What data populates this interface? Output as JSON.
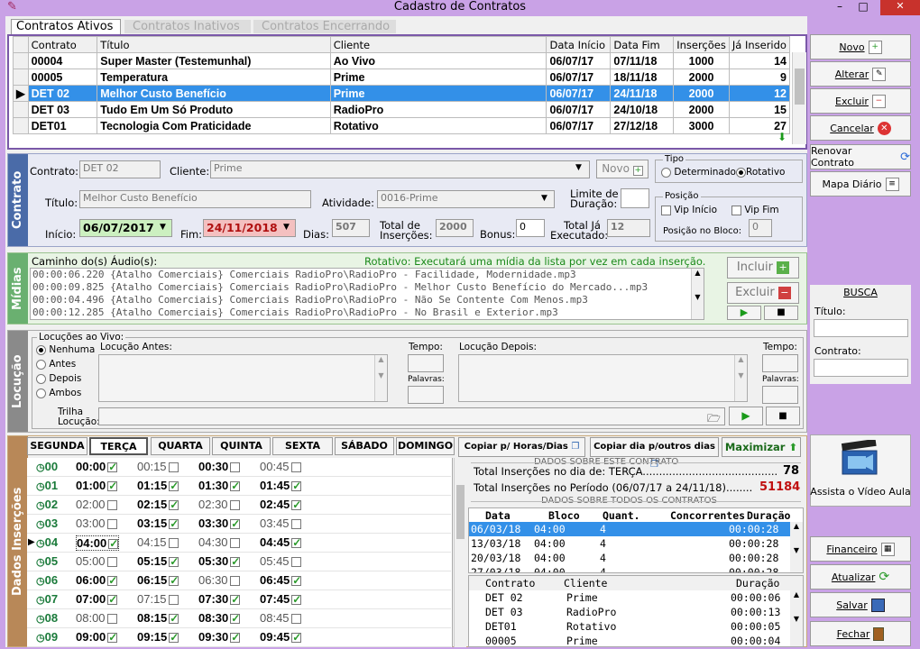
{
  "window": {
    "title": "Cadastro de Contratos",
    "min": "–",
    "max": "□",
    "close": "✕"
  },
  "tabs": [
    "Contratos Ativos",
    "Contratos Inativos",
    "Contratos Encerrando"
  ],
  "table": {
    "headers": [
      "Contrato",
      "Título",
      "Cliente",
      "Data Início",
      "Data Fim",
      "Inserções",
      "Já Inserido"
    ],
    "rows": [
      [
        "00004",
        "Super Master (Testemunhal)",
        "Ao Vivo",
        "06/07/17",
        "07/11/18",
        "1000",
        "14"
      ],
      [
        "00005",
        "Temperatura",
        "Prime",
        "06/07/17",
        "18/11/18",
        "2000",
        "9"
      ],
      [
        "DET 02",
        "Melhor Custo Benefício",
        "Prime",
        "06/07/17",
        "24/11/18",
        "2000",
        "12"
      ],
      [
        "DET 03",
        "Tudo Em Um Só Produto",
        "RadioPro",
        "06/07/17",
        "24/10/18",
        "2000",
        "15"
      ],
      [
        "DET01",
        "Tecnologia Com Praticidade",
        "Rotativo",
        "06/07/17",
        "27/12/18",
        "3000",
        "27"
      ]
    ],
    "selected_row": 2
  },
  "side": {
    "novo": "Novo",
    "alterar": "Alterar",
    "excluir": "Excluir",
    "cancelar": "Cancelar",
    "renovar": "Renovar Contrato",
    "mapa": "Mapa Diário",
    "busca": "BUSCA",
    "titulo_lbl": "Título:",
    "contrato_lbl": "Contrato:",
    "video": "Assista o Vídeo Aula",
    "financeiro": "Financeiro",
    "atualizar": "Atualizar",
    "salvar": "Salvar",
    "fechar": "Fechar"
  },
  "contrato": {
    "section": "Contrato",
    "contrato_lbl": "Contrato:",
    "contrato_val": "DET 02",
    "cliente_lbl": "Cliente:",
    "cliente_val": "Prime",
    "novo_btn": "Novo",
    "titulo_lbl": "Título:",
    "titulo_val": "Melhor Custo Benefício",
    "atividade_lbl": "Atividade:",
    "atividade_val": "0016-Prime",
    "limite_lbl1": "Limite de",
    "limite_lbl2": "Duração:",
    "inicio_lbl": "Início:",
    "inicio_val": "06/07/2017",
    "fim_lbl": "Fim:",
    "fim_val": "24/11/2018",
    "dias_lbl": "Dias:",
    "dias_val": "507",
    "total_ins_lbl1": "Total de",
    "total_ins_lbl2": "Inserções:",
    "total_ins_val": "2000",
    "bonus_lbl": "Bonus:",
    "bonus_val": "0",
    "total_exec_lbl1": "Total Já",
    "total_exec_lbl2": "Executado:",
    "total_exec_val": "12",
    "tipo_lbl": "Tipo",
    "determinado": "Determinado",
    "rotativo": "Rotativo",
    "posicao_lbl": "Posição",
    "vip_inicio": "Vip Início",
    "vip_fim": "Vip Fim",
    "posicao_bloco_lbl": "Posição no Bloco:",
    "posicao_bloco_val": "0"
  },
  "midias": {
    "section": "Mídias",
    "caminho_lbl": "Caminho  do(s)  Áudio(s):",
    "rotativo_info": "Rotativo: Executará uma mídia da lista por vez em cada inserção.",
    "files": [
      "00:00:06.220 {Atalho Comerciais} Comerciais RadioPro\\RadioPro - Facilidade, Modernidade.mp3",
      "00:00:09.825 {Atalho Comerciais} Comerciais RadioPro\\RadioPro - Melhor Custo Benefício do Mercado...mp3",
      "00:00:04.496 {Atalho Comerciais} Comerciais RadioPro\\RadioPro - Não Se Contente Com Menos.mp3",
      "00:00:12.285 {Atalho Comerciais} Comerciais RadioPro\\RadioPro - No Brasil e Exterior.mp3"
    ],
    "incluir": "Incluir",
    "excluir": "Excluir"
  },
  "locucao": {
    "section": "Locução",
    "group_lbl": "Locuções ao Vivo:",
    "options": [
      "Nenhuma",
      "Antes",
      "Depois",
      "Ambos"
    ],
    "antes_lbl": "Locução Antes:",
    "tempo_lbl": "Tempo:",
    "palavras_lbl": "Palavras:",
    "depois_lbl": "Locução Depois:",
    "trilha_lbl1": "Trilha",
    "trilha_lbl2": "Locução:"
  },
  "insercoes": {
    "section": "Dados Inserções",
    "days": [
      "SEGUNDA",
      "TERÇA",
      "QUARTA",
      "QUINTA",
      "SEXTA",
      "SÁBADO",
      "DOMINGO"
    ],
    "active_day": 1,
    "copiar_horas": "Copiar p/ Horas/Dias",
    "copiar_dia": "Copiar dia p/outros dias",
    "maximizar": "Maximizar",
    "hours": [
      {
        "h": "00",
        "slots": [
          [
            "00:00",
            true,
            true
          ],
          [
            "00:15",
            false,
            false
          ],
          [
            "00:30",
            true,
            false
          ],
          [
            "00:45",
            false,
            false
          ]
        ]
      },
      {
        "h": "01",
        "slots": [
          [
            "01:00",
            true,
            true
          ],
          [
            "01:15",
            true,
            true
          ],
          [
            "01:30",
            true,
            true
          ],
          [
            "01:45",
            true,
            true
          ]
        ]
      },
      {
        "h": "02",
        "slots": [
          [
            "02:00",
            false,
            false
          ],
          [
            "02:15",
            true,
            true
          ],
          [
            "02:30",
            false,
            false
          ],
          [
            "02:45",
            true,
            true
          ]
        ]
      },
      {
        "h": "03",
        "slots": [
          [
            "03:00",
            false,
            false
          ],
          [
            "03:15",
            true,
            true
          ],
          [
            "03:30",
            true,
            true
          ],
          [
            "03:45",
            false,
            false
          ]
        ]
      },
      {
        "h": "04",
        "slots": [
          [
            "04:00",
            true,
            true
          ],
          [
            "04:15",
            false,
            false
          ],
          [
            "04:30",
            false,
            false
          ],
          [
            "04:45",
            true,
            true
          ]
        ]
      },
      {
        "h": "05",
        "slots": [
          [
            "05:00",
            false,
            false
          ],
          [
            "05:15",
            true,
            true
          ],
          [
            "05:30",
            true,
            true
          ],
          [
            "05:45",
            false,
            false
          ]
        ]
      },
      {
        "h": "06",
        "slots": [
          [
            "06:00",
            true,
            true
          ],
          [
            "06:15",
            true,
            true
          ],
          [
            "06:30",
            false,
            false
          ],
          [
            "06:45",
            true,
            true
          ]
        ]
      },
      {
        "h": "07",
        "slots": [
          [
            "07:00",
            true,
            true
          ],
          [
            "07:15",
            false,
            false
          ],
          [
            "07:30",
            true,
            true
          ],
          [
            "07:45",
            true,
            true
          ]
        ]
      },
      {
        "h": "08",
        "slots": [
          [
            "08:00",
            false,
            false
          ],
          [
            "08:15",
            true,
            true
          ],
          [
            "08:30",
            true,
            true
          ],
          [
            "08:45",
            false,
            false
          ]
        ]
      },
      {
        "h": "09",
        "slots": [
          [
            "09:00",
            true,
            true
          ],
          [
            "09:15",
            true,
            true
          ],
          [
            "09:30",
            true,
            true
          ],
          [
            "09:45",
            true,
            true
          ]
        ]
      }
    ],
    "dados_contrato_hdr": "DADOS SOBRE ESTE CONTRATO",
    "total_dia_lbl": "Total Inserções no dia de: TERÇA.........................................",
    "total_dia_val": "78",
    "total_periodo_lbl": "Total Inserções no Período (06/07/17 a 24/11/18)........",
    "total_periodo_val": "51184",
    "dados_todos_hdr": "DADOS SOBRE TODOS OS CONTRATOS",
    "conc_headers": [
      "Data",
      "Bloco",
      "Quant.",
      "Concorrentes",
      "Duração"
    ],
    "conc_rows": [
      [
        "06/03/18",
        "04:00",
        "4",
        "",
        "00:00:28"
      ],
      [
        "13/03/18",
        "04:00",
        "4",
        "",
        "00:00:28"
      ],
      [
        "20/03/18",
        "04:00",
        "4",
        "",
        "00:00:28"
      ],
      [
        "27/03/18",
        "04:00",
        "4",
        "",
        "00:00:28"
      ]
    ],
    "bloco_headers": [
      "Contrato",
      "Cliente",
      "Duração"
    ],
    "bloco_rows": [
      [
        "DET 02",
        "Prime",
        "00:00:06"
      ],
      [
        "DET 03",
        "RadioPro",
        "00:00:13"
      ],
      [
        "DET01",
        "Rotativo",
        "00:00:05"
      ],
      [
        "00005",
        "Prime",
        "00:00:04"
      ]
    ]
  }
}
